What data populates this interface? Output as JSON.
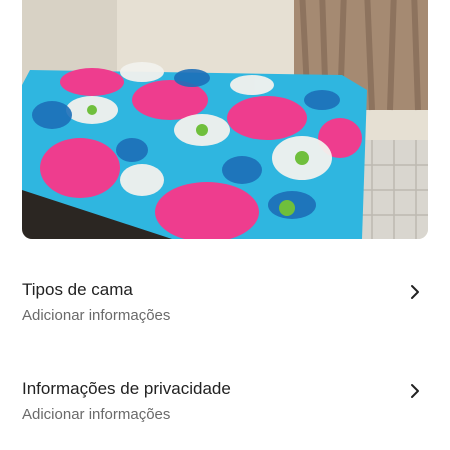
{
  "photo": {
    "icon": "bedroom-photo"
  },
  "rows": [
    {
      "title": "Tipos de cama",
      "subtitle": "Adicionar informações",
      "icon": "chevron-right-icon"
    },
    {
      "title": "Informações de privacidade",
      "subtitle": "Adicionar informações",
      "icon": "chevron-right-icon"
    }
  ],
  "colors": {
    "text_primary": "#222222",
    "text_secondary": "#6a6a6a",
    "background": "#ffffff"
  }
}
